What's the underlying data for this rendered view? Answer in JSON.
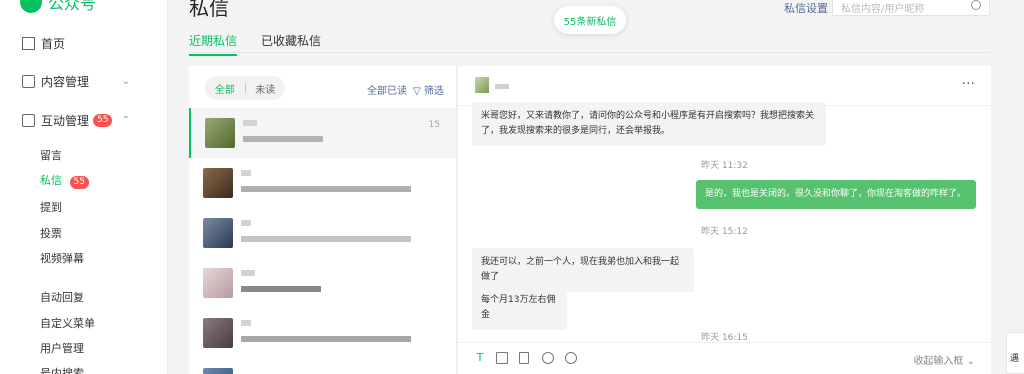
{
  "app": {
    "name": "公众号"
  },
  "sidebar": {
    "home": "首页",
    "content": "内容管理",
    "interaction": "互动管理",
    "interaction_badge": "55",
    "sub": {
      "comments": "留言",
      "messages": "私信",
      "messages_badge": "55",
      "checkin": "提到",
      "vote": "投票",
      "danmu": "视频弹幕",
      "auto_reply": "自动回复",
      "custom_menu": "自定义菜单",
      "user_mgmt": "用户管理",
      "search": "号内搜索"
    }
  },
  "header": {
    "title": "私信",
    "settings": "私信设置",
    "search_placeholder": "私信内容/用户昵称",
    "new_messages": "55条新私信"
  },
  "tabs": {
    "recent": "近期私信",
    "starred": "已收藏私信"
  },
  "list": {
    "filter_all": "全部",
    "filter_unread": "未读",
    "mark_all_read": "全部已读",
    "filter": "筛选",
    "first_time": "15"
  },
  "chat": {
    "messages": [
      {
        "text": "米哥您好，又来请教你了，请问你的公众号和小程序是有开启搜索吗？我想把搜索关了，我发现搜索来的很多是同行，还会举报我。"
      },
      {
        "time": "昨天 11:32"
      },
      {
        "text": "是的，我也是关闭的。很久没和你聊了，你现在淘客做的咋样了。"
      },
      {
        "time": "昨天 15:12"
      },
      {
        "text": "我还可以，之前一个人，现在我弟也加入和我一起做了"
      },
      {
        "text": "每个月13万左右佣金"
      },
      {
        "time": "昨天 16:15"
      }
    ],
    "collapse": "收起输入框"
  },
  "side_float": {
    "label": "遇"
  },
  "colors": {
    "accent": "#07c160",
    "badge": "#fa5151",
    "link": "#576b95"
  }
}
